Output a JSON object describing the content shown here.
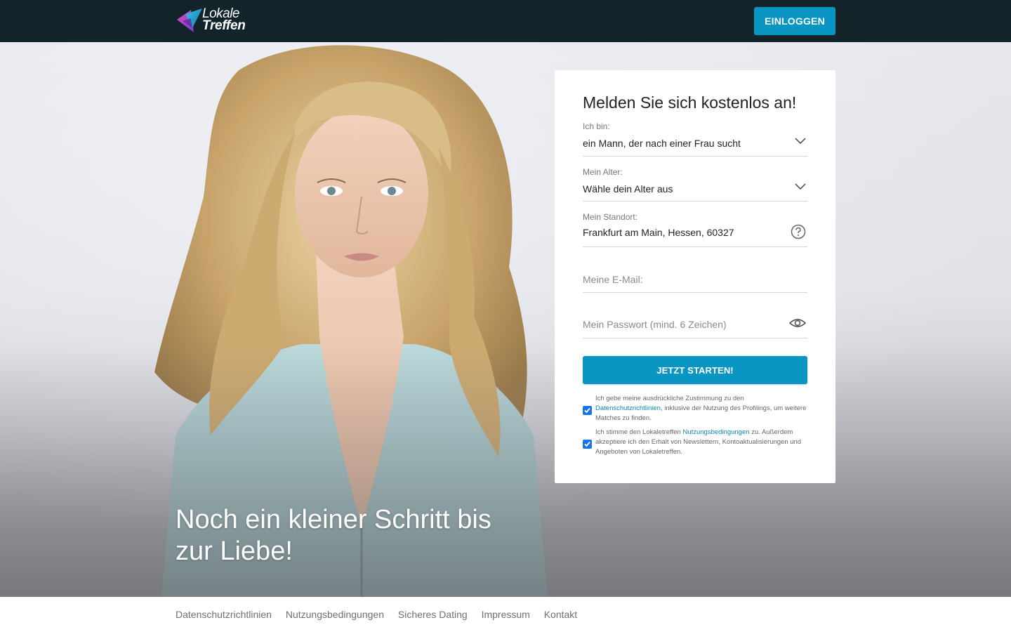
{
  "header": {
    "logo_line1": "Lokale",
    "logo_line2": "Treffen",
    "login_label": "EINLOGGEN"
  },
  "hero": {
    "headline_line1": "Noch ein kleiner Schritt bis",
    "headline_line2": "zur Liebe!"
  },
  "form": {
    "title": "Melden Sie sich kostenlos an!",
    "gender": {
      "label": "Ich bin:",
      "value": "ein Mann, der nach einer Frau sucht"
    },
    "age": {
      "label": "Mein Alter:",
      "value": "Wähle dein Alter aus"
    },
    "location": {
      "label": "Mein Standort:",
      "value": "Frankfurt am Main, Hessen, 60327"
    },
    "email": {
      "placeholder": "Meine E-Mail:"
    },
    "password": {
      "placeholder": "Mein Passwort (mind. 6 Zeichen)"
    },
    "submit_label": "JETZT STARTEN!",
    "consent1": {
      "checked": true,
      "pre": "Ich gebe meine ausdrückliche Zustimmung zu den",
      "link": "Datenschutzrichtlinien",
      "post": ", inklusive der Nutzung des Profilings, um weitere Matches zu finden."
    },
    "consent2": {
      "checked": true,
      "pre": "Ich stimme den Lokaletreffen",
      "link": "Nutzungsbedingungen",
      "post": "zu. Außerdem akzeptiere ich den Erhalt von Newslettern, Kontoaktualisierungen und Angeboten von Lokaletreffen."
    }
  },
  "footer": {
    "links": [
      "Datenschutzrichtlinien",
      "Nutzungsbedingungen",
      "Sicheres Dating",
      "Impressum",
      "Kontakt"
    ]
  },
  "colors": {
    "header_bg": "#12232a",
    "accent": "#0a96c3",
    "checkbox": "#1a73e8"
  },
  "icons": [
    "logo-mark-icon",
    "chevron-down-icon",
    "help-circle-icon",
    "eye-icon",
    "checkmark-icon"
  ]
}
